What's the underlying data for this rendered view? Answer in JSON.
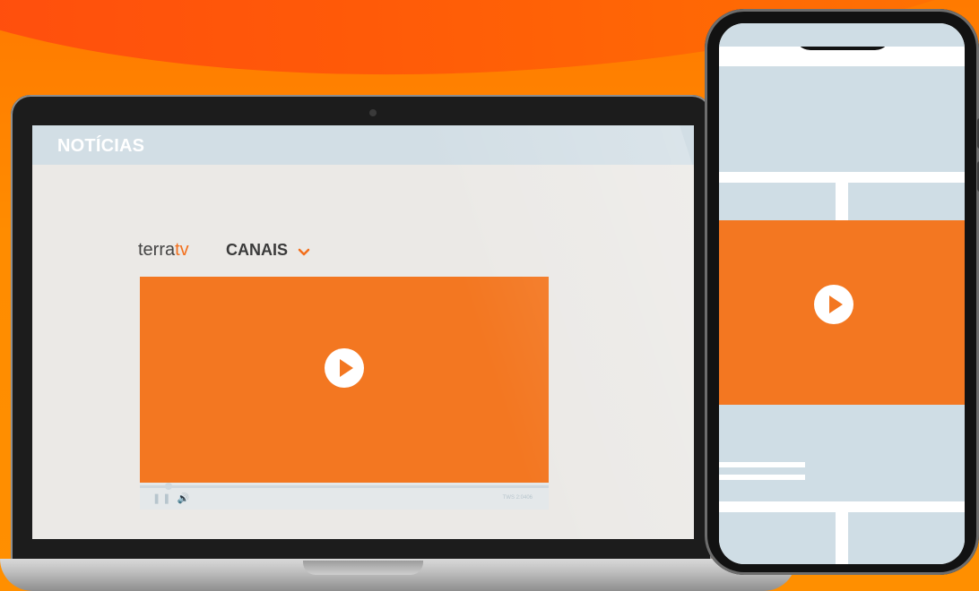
{
  "background": {
    "primary_color": "#ff8a00",
    "accent_color": "#f37721"
  },
  "laptop": {
    "page_title": "NOTÍCIAS",
    "brand": {
      "part1": "terra",
      "part2": "tv"
    },
    "channels_label": "CANAIS",
    "player": {
      "time_text": "TWS 2:0406",
      "icons": "❚❚ 🔊"
    }
  },
  "phone": {
    "player": {
      "state": "paused"
    }
  }
}
